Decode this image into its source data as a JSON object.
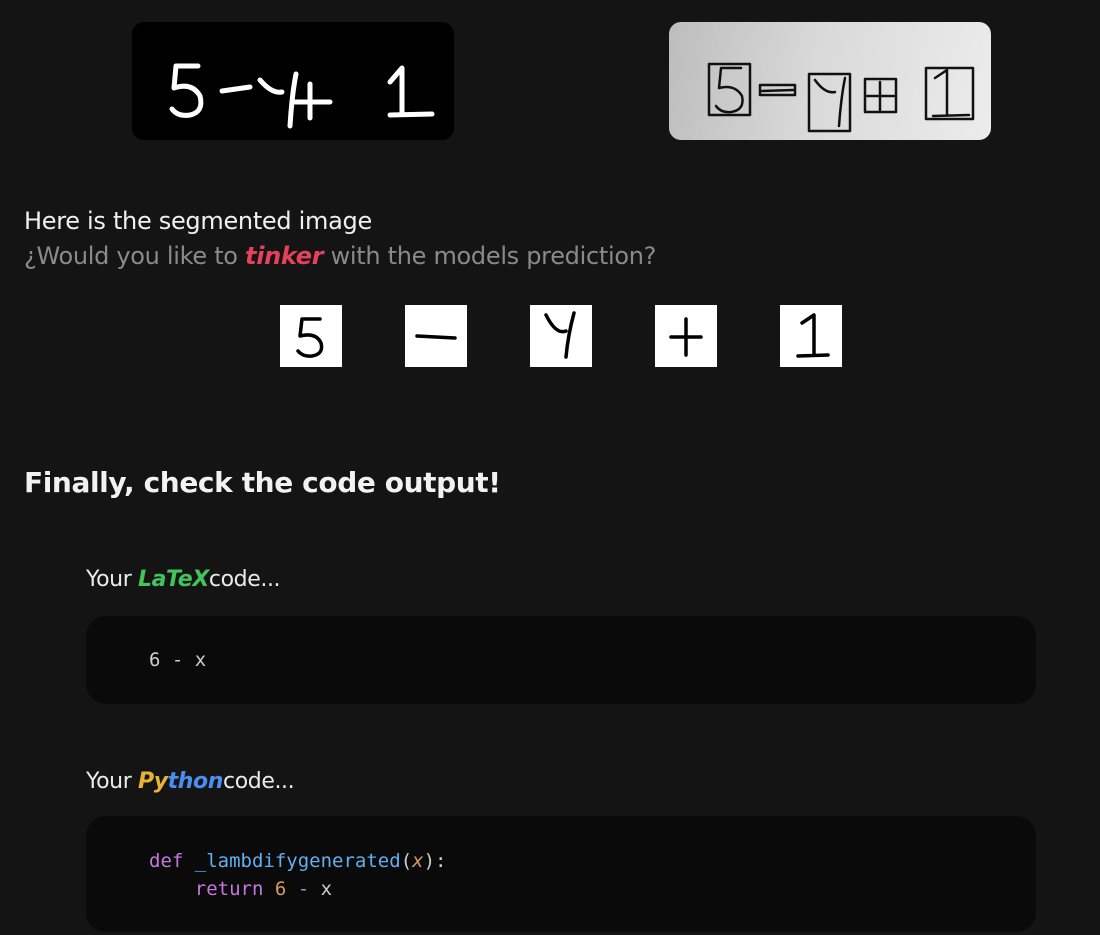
{
  "images": {
    "original_alt": "Handwritten expression 5 - y + 1",
    "segmented_alt": "Segmented handwritten expression with bounding boxes"
  },
  "segmentation": {
    "heading": "Here is the segmented image",
    "question_prefix": "¿Would you like to",
    "question_highlight": "tinker",
    "question_suffix": "with the models prediction?",
    "glyphs": [
      "5",
      "-",
      "y",
      "+",
      "1"
    ]
  },
  "final": {
    "heading": "Finally, check the code output!"
  },
  "latex": {
    "label_prefix": "Your",
    "label_word": "LaTeX",
    "label_suffix": "code...",
    "code": "6 - x"
  },
  "python": {
    "label_prefix": "Your",
    "label_word_a": "Py",
    "label_word_b": "thon",
    "label_suffix": "code...",
    "kw_def": "def",
    "fn_name": "_lambdifygenerated",
    "paren_open": "(",
    "param": "x",
    "paren_close": "):",
    "kw_return": "return",
    "num": "6",
    "op": "-",
    "var": "x"
  }
}
